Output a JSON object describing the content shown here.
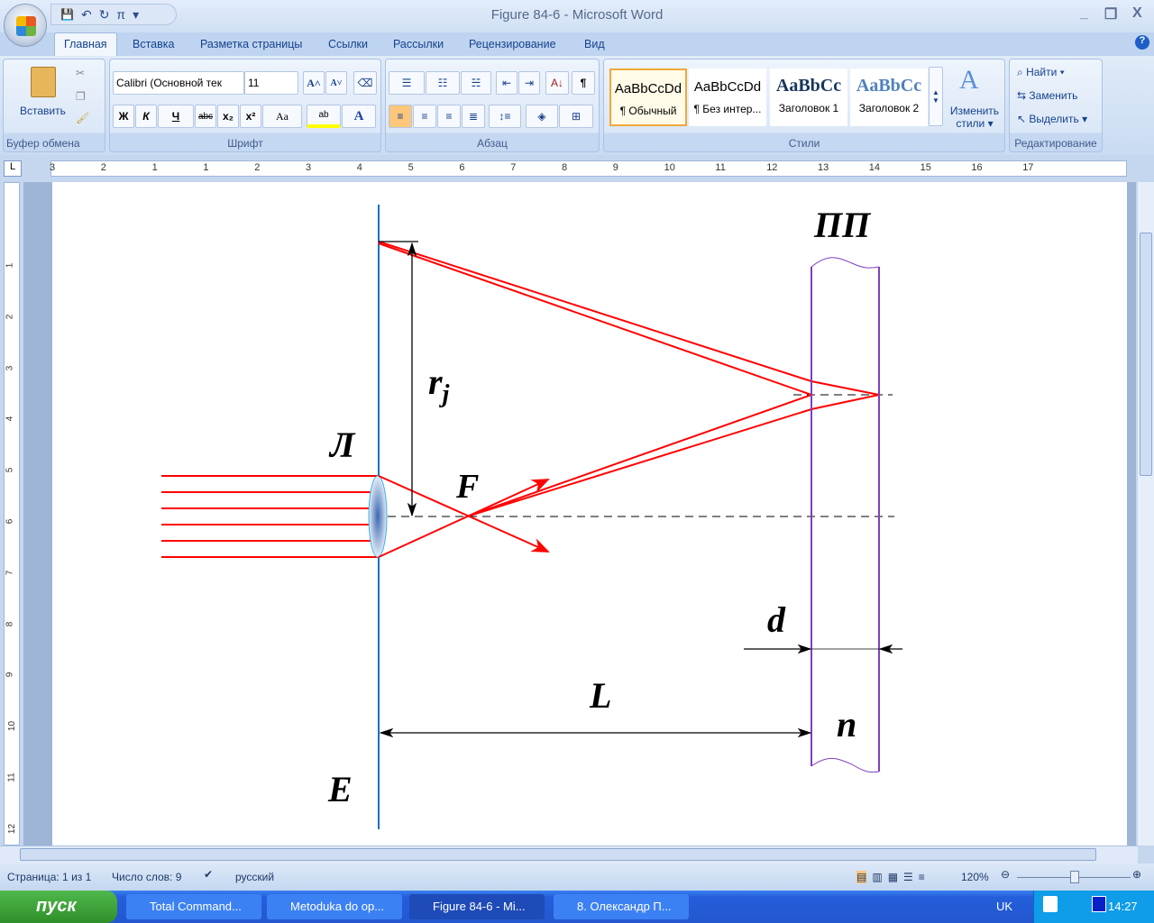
{
  "window": {
    "title": "Figure 84-6 - Microsoft Word",
    "minimize": "_",
    "restore": "❐",
    "close": "X"
  },
  "qat": {
    "save": "💾",
    "undo": "↶",
    "redo": "↻",
    "pi": "π",
    "customize": "▾"
  },
  "tabs": [
    "Главная",
    "Вставка",
    "Разметка страницы",
    "Ссылки",
    "Рассылки",
    "Рецензирование",
    "Вид"
  ],
  "help": "?",
  "ribbon": {
    "clipboard": {
      "label": "Буфер обмена",
      "paste": "Вставить"
    },
    "font": {
      "label": "Шрифт",
      "name": "Calibri (Основной тек",
      "size": "11",
      "bold": "Ж",
      "italic": "К",
      "underline": "Ч",
      "strike": "abc",
      "sub": "x₂",
      "sup": "x²",
      "case": "Aa",
      "grow": "A˄",
      "shrink": "A˅",
      "highlight": "ab",
      "color": "A"
    },
    "paragraph": {
      "label": "Абзац",
      "pilcrow": "¶"
    },
    "styles": {
      "label": "Стили",
      "items": [
        {
          "preview": "AaBbCcDd",
          "name": "¶ Обычный"
        },
        {
          "preview": "AaBbCcDd",
          "name": "¶ Без интер..."
        },
        {
          "preview": "AaBbCc",
          "name": "Заголовок 1"
        },
        {
          "preview": "AaBbCc",
          "name": "Заголовок 2"
        }
      ],
      "change": "Изменить стили ▾"
    },
    "editing": {
      "label": "Редактирование",
      "find": "Найти ▾",
      "replace": "Заменить",
      "select": "Выделить ▾"
    }
  },
  "ruler": {
    "ticks": [
      "3",
      "2",
      "1",
      "1",
      "2",
      "3",
      "4",
      "5",
      "6",
      "7",
      "8",
      "9",
      "10",
      "11",
      "12",
      "13",
      "14",
      "15",
      "16",
      "17"
    ],
    "vticks": [
      "1",
      "2",
      "3",
      "4",
      "5",
      "6",
      "7",
      "8",
      "9",
      "10",
      "11",
      "12"
    ]
  },
  "diagram": {
    "labels": {
      "screen": "ПП",
      "radius": "r",
      "radius_sub": "j",
      "lens": "Л",
      "focus": "F",
      "thickness": "d",
      "distance": "L",
      "index": "n",
      "plane": "E"
    },
    "colors": {
      "rays": "#ff0000",
      "plate": "#7f3fbf",
      "lens_plane": "#1f6fc0"
    }
  },
  "status": {
    "page": "Страница: 1 из 1",
    "words": "Число слов: 9",
    "lang": "русский",
    "zoom": "120%"
  },
  "taskbar": {
    "start": "пуск",
    "tasks": [
      "Total Command...",
      "Metoduka do op...",
      "Figure 84-6 - Mi...",
      "8. Олександр П..."
    ],
    "lang": "UK",
    "time": "14:27"
  }
}
